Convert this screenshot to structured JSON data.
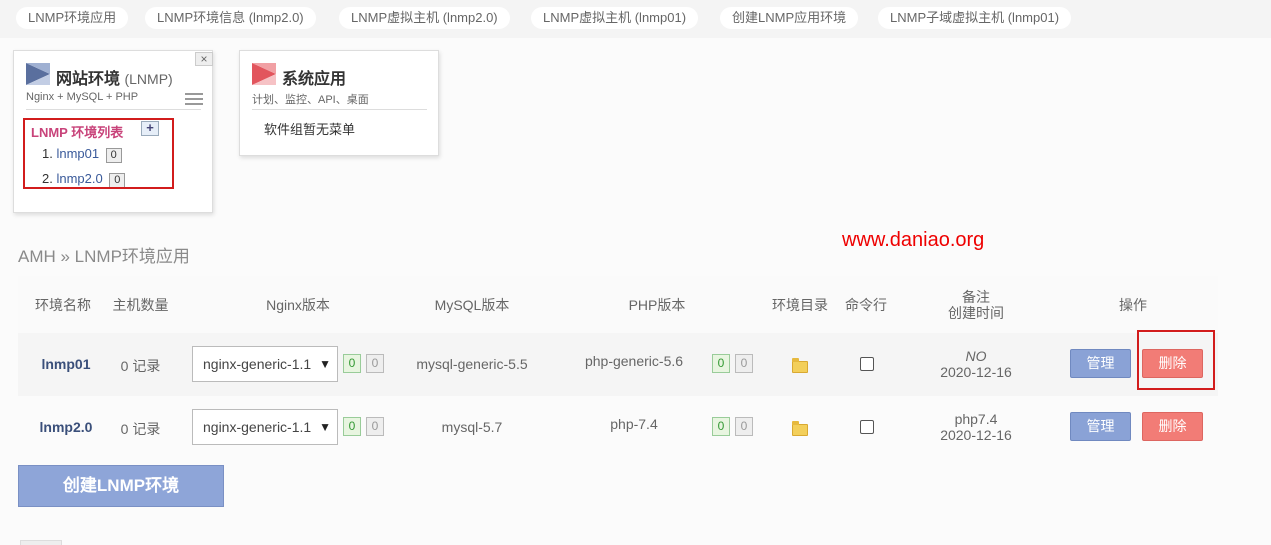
{
  "tabs": [
    "LNMP环境应用",
    "LNMP环境信息 (lnmp2.0)",
    "LNMP虚拟主机 (lnmp2.0)",
    "LNMP虚拟主机 (lnmp01)",
    "创建LNMP应用环境",
    "LNMP子域虚拟主机 (lnmp01)"
  ],
  "panel_site": {
    "title": "网站环境",
    "title_suffix": "(LNMP)",
    "subtitle": "Nginx + MySQL + PHP",
    "close": "×",
    "env_list_title": "LNMP 环境列表",
    "add": "+",
    "envs": [
      {
        "num": "1.",
        "name": "lnmp01",
        "count": "0"
      },
      {
        "num": "2.",
        "name": "lnmp2.0",
        "count": "0"
      }
    ]
  },
  "panel_sys": {
    "title": "系统应用",
    "subtitle": "计划、监控、API、桌面",
    "empty": "软件组暂无菜单"
  },
  "breadcrumb": "AMH » LNMP环境应用",
  "watermark": "www.daniao.org",
  "table": {
    "headers": {
      "name": "环境名称",
      "hosts": "主机数量",
      "nginx": "Nginx版本",
      "mysql": "MySQL版本",
      "php": "PHP版本",
      "dir": "环境目录",
      "cmd": "命令行",
      "note": "备注",
      "created": "创建时间",
      "ops": "操作"
    },
    "rows": [
      {
        "name": "lnmp01",
        "hosts": "0 记录",
        "nginx": "nginx-generic-1.1",
        "nginx_counts": [
          "0",
          "0"
        ],
        "mysql": "mysql-generic-5.5",
        "php": "php-generic-5.6",
        "php_counts": [
          "0",
          "0"
        ],
        "note": "NO",
        "created": "2020-12-16",
        "manage": "管理",
        "delete": "删除"
      },
      {
        "name": "lnmp2.0",
        "hosts": "0 记录",
        "nginx": "nginx-generic-1.1",
        "nginx_counts": [
          "0",
          "0"
        ],
        "mysql": "mysql-5.7",
        "php": "php-7.4",
        "php_counts": [
          "0",
          "0"
        ],
        "note": "php7.4",
        "created": "2020-12-16",
        "manage": "管理",
        "delete": "删除"
      }
    ]
  },
  "create_button": "创建LNMP环境",
  "colors": {
    "accent_blue": "#8aa2d6",
    "delete_red": "#f27c76",
    "highlight_box": "#d21c1c",
    "env_list_title": "#c8437a"
  }
}
